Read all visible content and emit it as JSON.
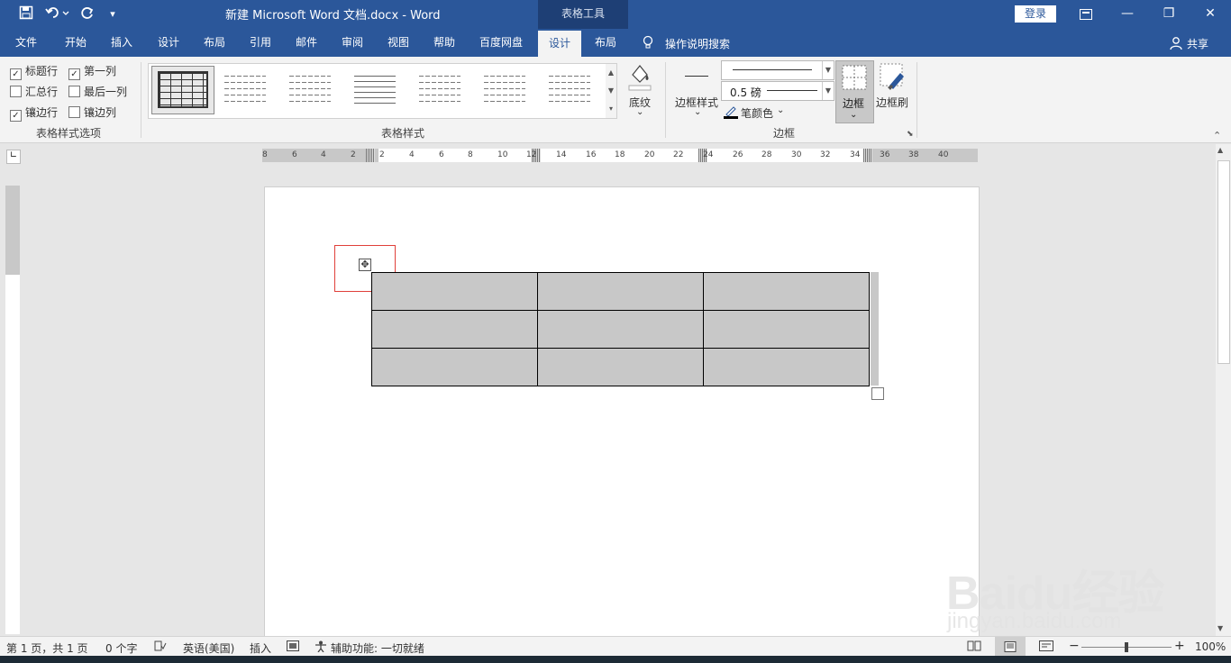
{
  "titlebar": {
    "save_icon": "save-icon",
    "undo_icon": "undo-icon",
    "redo_icon": "redo-icon",
    "doc_title": "新建 Microsoft Word 文档.docx  -  Word",
    "tools_tab": "表格工具",
    "login": "登录",
    "window_buttons": [
      "ribbon-display-icon",
      "minimize-icon",
      "restore-icon",
      "close-icon"
    ]
  },
  "tabs": {
    "items": [
      "文件",
      "开始",
      "插入",
      "设计",
      "布局",
      "引用",
      "邮件",
      "审阅",
      "视图",
      "帮助",
      "百度网盘",
      "设计",
      "布局"
    ],
    "active_index": 11,
    "tell_me": "操作说明搜索",
    "share": "共享"
  },
  "ribbon": {
    "style_options": {
      "label": "表格样式选项",
      "checkboxes": [
        {
          "label": "标题行",
          "checked": true
        },
        {
          "label": "第一列",
          "checked": true
        },
        {
          "label": "汇总行",
          "checked": false
        },
        {
          "label": "最后一列",
          "checked": false
        },
        {
          "label": "镶边行",
          "checked": true
        },
        {
          "label": "镶边列",
          "checked": false
        }
      ]
    },
    "table_styles": {
      "label": "表格样式",
      "shading": "底纹"
    },
    "borders": {
      "label": "边框",
      "border_styles": "边框样式",
      "weight": "0.5 磅",
      "pen_color": "笔颜色",
      "borders_btn": "边框",
      "border_painter": "边框刷"
    }
  },
  "ruler": {
    "h_labels": [
      "8",
      "6",
      "4",
      "2",
      "2",
      "4",
      "6",
      "8",
      "10",
      "12",
      "14",
      "16",
      "18",
      "20",
      "22",
      "24",
      "26",
      "28",
      "30",
      "32",
      "34",
      "36",
      "38",
      "40"
    ]
  },
  "status": {
    "page": "第 1 页，共 1 页",
    "words": "0 个字",
    "language": "英语(美国)",
    "mode": "插入",
    "accessibility": "辅助功能: 一切就绪",
    "zoom": "100%"
  },
  "watermark": {
    "brand": "Baidu经验",
    "url": "jingyan.baidu.com"
  }
}
